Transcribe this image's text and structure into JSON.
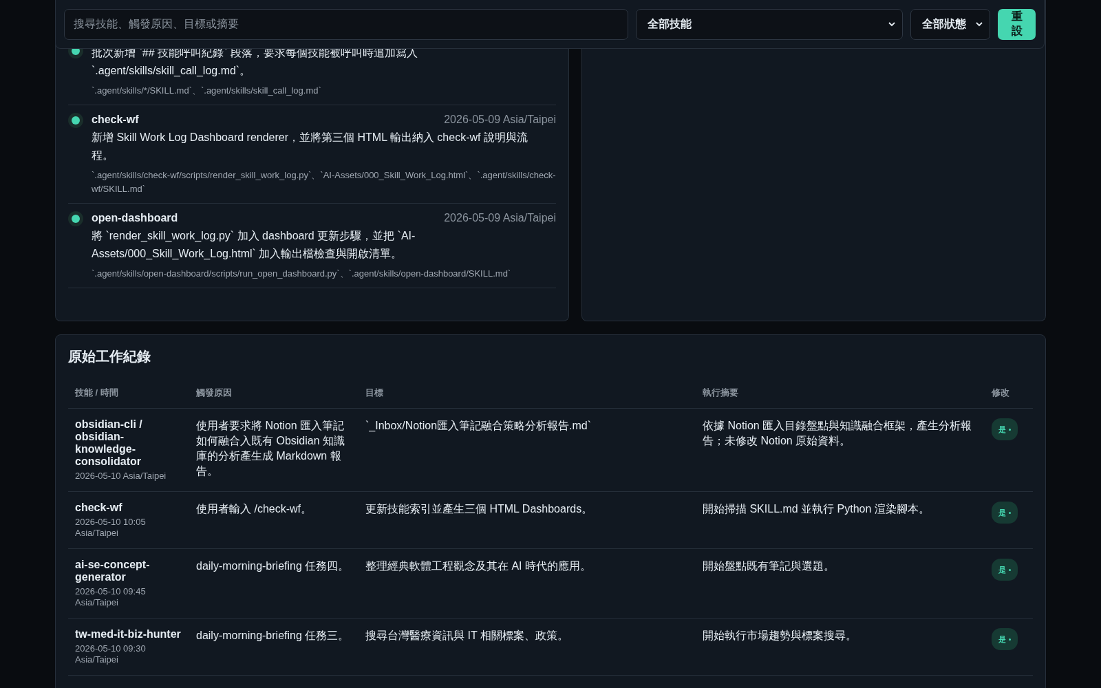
{
  "filter_bar": {
    "search": {
      "placeholder": "搜尋技能、觸發原因、目標或摘要"
    },
    "skill_filter": {
      "value": "全部技能"
    },
    "status_filter": {
      "value": "全部狀態"
    },
    "reset_button": "重設"
  },
  "timeline": {
    "items": [
      {
        "description": "批次新增 `## 技能呼叫紀錄` 段落，要求每個技能被呼叫時追加寫入 `.agent/skills/skill_call_log.md`。",
        "files": "`.agent/skills/*/SKILL.md`、`.agent/skills/skill_call_log.md`"
      },
      {
        "name": "check-wf",
        "date": "2026-05-09 Asia/Taipei",
        "description": "新增 Skill Work Log Dashboard renderer，並將第三個 HTML 輸出納入 check-wf 說明與流程。",
        "files": "`.agent/skills/check-wf/scripts/render_skill_work_log.py`、`AI-Assets/000_Skill_Work_Log.html`、`.agent/skills/check-wf/SKILL.md`"
      },
      {
        "name": "open-dashboard",
        "date": "2026-05-09 Asia/Taipei",
        "description": "將 `render_skill_work_log.py` 加入 dashboard 更新步驟，並把 `AI-Assets/000_Skill_Work_Log.html` 加入輸出檔檢查與開啟清單。",
        "files": "`.agent/skills/open-dashboard/scripts/run_open_dashboard.py`、`.agent/skills/open-dashboard/SKILL.md`"
      }
    ]
  },
  "work_log": {
    "title": "原始工作紀錄",
    "columns": [
      "技能 / 時間",
      "觸發原因",
      "目標",
      "執行摘要",
      "修改"
    ],
    "rows": [
      {
        "skill": "obsidian-cli / obsidian-knowledge-consolidator",
        "time": "2026-05-10 Asia/Taipei",
        "trigger": "使用者要求將 Notion 匯入筆記如何融合入既有 Obsidian 知識庫的分析產生成 Markdown 報告。",
        "goal": "`_Inbox/Notion匯入筆記融合策略分析報告.md`",
        "summary": "依據 Notion 匯入目錄盤點與知識融合框架，產生分析報告；未修改 Notion 原始資料。",
        "modified": "是",
        "changed": true
      },
      {
        "skill": "check-wf",
        "time": "2026-05-10 10:05 Asia/Taipei",
        "trigger": "使用者輸入 /check-wf。",
        "goal": "更新技能索引並產生三個 HTML Dashboards。",
        "summary": "開始掃描 SKILL.md 並執行 Python 渲染腳本。",
        "modified": "是",
        "changed": true
      },
      {
        "skill": "ai-se-concept-generator",
        "time": "2026-05-10 09:45 Asia/Taipei",
        "trigger": "daily-morning-briefing 任務四。",
        "goal": "整理經典軟體工程觀念及其在 AI 時代的應用。",
        "summary": "開始盤點既有筆記與選題。",
        "modified": "是",
        "changed": true
      },
      {
        "skill": "tw-med-it-biz-hunter",
        "time": "2026-05-10 09:30 Asia/Taipei",
        "trigger": "daily-morning-briefing 任務三。",
        "goal": "搜尋台灣醫療資訊與 IT 相關標案、政策。",
        "summary": "開始執行市場趨勢與標案搜尋。",
        "modified": "是",
        "changed": true
      }
    ]
  }
}
